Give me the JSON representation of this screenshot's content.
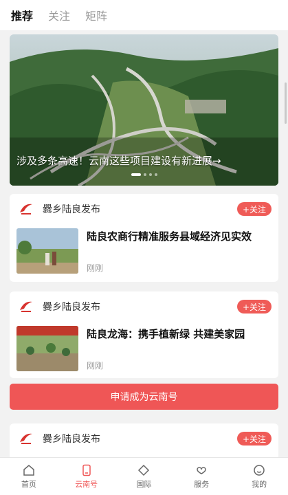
{
  "top_tabs": [
    {
      "label": "推荐",
      "active": true
    },
    {
      "label": "关注",
      "active": false
    },
    {
      "label": "矩阵",
      "active": false
    }
  ],
  "hero": {
    "caption": "涉及多条高速！云南这些项目建设有新进展→",
    "dots": 4,
    "active_dot": 0
  },
  "cards": [
    {
      "account": "爨乡陆良发布",
      "follow_label": "+关注",
      "title": "陆良农商行精准服务县域经济见实效",
      "time": "刚刚"
    },
    {
      "account": "爨乡陆良发布",
      "follow_label": "+关注",
      "title": "陆良龙海：携手植新绿 共建美家园",
      "time": "刚刚"
    },
    {
      "account": "爨乡陆良发布",
      "follow_label": "+关注"
    }
  ],
  "apply_button": "申请成为云南号",
  "bottom_tabs": [
    {
      "label": "首页",
      "icon": "home-icon"
    },
    {
      "label": "云南号",
      "icon": "phone-icon",
      "active": true
    },
    {
      "label": "国际",
      "icon": "diamond-icon"
    },
    {
      "label": "服务",
      "icon": "heart-hand-icon"
    },
    {
      "label": "我的",
      "icon": "face-icon"
    }
  ],
  "colors": {
    "accent": "#ef5656",
    "follow": "#ef5b57"
  }
}
